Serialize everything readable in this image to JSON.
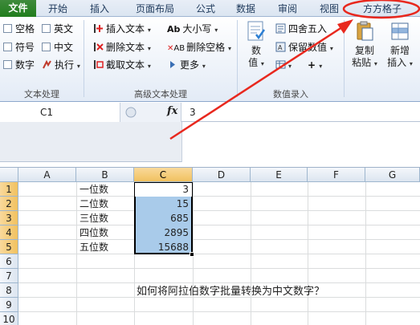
{
  "tabs": {
    "file": "文件",
    "home": "开始",
    "insert": "插入",
    "layout": "页面布局",
    "formula": "公式",
    "data": "数据",
    "review": "审阅",
    "view": "视图",
    "custom": "方方格子"
  },
  "ribbon": {
    "text_group": {
      "label": "文本处理",
      "items": [
        "空格",
        "英文",
        "符号",
        "中文",
        "数字",
        "执行"
      ]
    },
    "adv_text_group": {
      "label": "高级文本处理",
      "insert_text": "插入文本",
      "delete_text": "删除文本",
      "extract_text": "截取文本",
      "case": "大小写",
      "delete_space": "删除空格",
      "more": "更多"
    },
    "number_group": {
      "label": "数值录入",
      "value_btn_line1": "数",
      "value_btn_line2": "值",
      "round": "四舍五入",
      "keep_value": "保留数值",
      "plus": "+"
    },
    "copy_group": {
      "copy_line1": "复制",
      "copy_line2": "粘贴",
      "add_line1": "新增",
      "add_line2": "插入"
    }
  },
  "formula_bar": {
    "name_box": "C1",
    "fx": "fx",
    "value": "3"
  },
  "sheet": {
    "columns": [
      "A",
      "B",
      "C",
      "D",
      "E",
      "F",
      "G"
    ],
    "rows": [
      "1",
      "2",
      "3",
      "4",
      "5",
      "6",
      "7",
      "8",
      "9",
      "10"
    ],
    "b_cells": [
      "一位数",
      "二位数",
      "三位数",
      "四位数",
      "五位数"
    ],
    "c_cells": [
      "3",
      "15",
      "685",
      "2895",
      "15688"
    ],
    "note": "如何将阿拉伯数字批量转换为中文数字？"
  },
  "colors": {
    "accent_red": "#e8281e",
    "selection": "#a9cbea",
    "header_selected": "#f1c15f",
    "file_tab": "#207d1c"
  }
}
